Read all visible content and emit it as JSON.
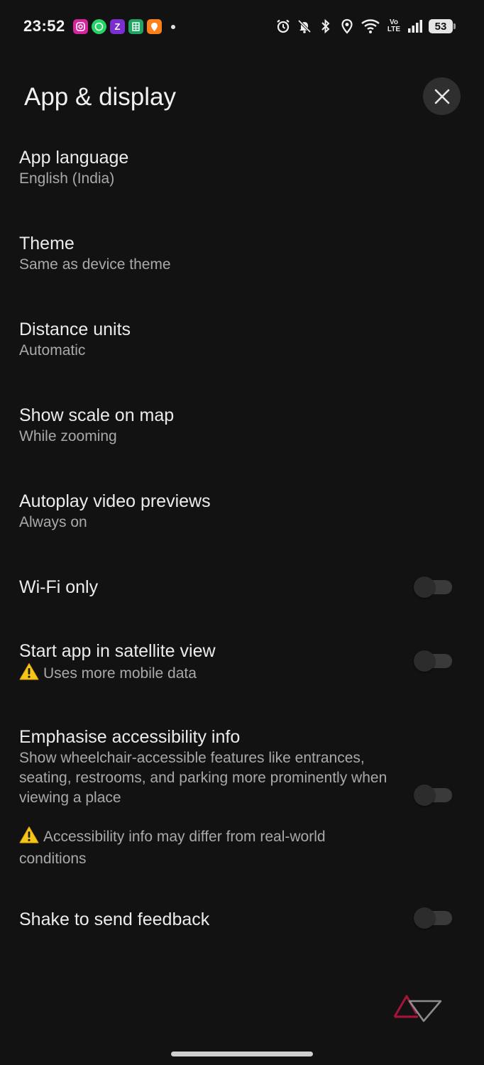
{
  "status_bar": {
    "time": "23:52",
    "battery": "53",
    "volte_top": "Vo",
    "volte_bottom": "LTE",
    "notification_icons": [
      {
        "name": "instagram-icon",
        "color": "#d6249f",
        "glyph": "◎"
      },
      {
        "name": "whatsapp-icon",
        "color": "#25d366",
        "glyph": "✆"
      },
      {
        "name": "zomato-z-icon",
        "color": "#7b2fd0",
        "glyph": "Z"
      },
      {
        "name": "sheets-icon",
        "color": "#1fa463",
        "glyph": "▦"
      },
      {
        "name": "swiggy-icon",
        "color": "#fc8019",
        "glyph": "●"
      }
    ]
  },
  "header": {
    "title": "App & display"
  },
  "settings": [
    {
      "title": "App language",
      "subtitle": "English (India)"
    },
    {
      "title": "Theme",
      "subtitle": "Same as device theme"
    },
    {
      "title": "Distance units",
      "subtitle": "Automatic"
    },
    {
      "title": "Show scale on map",
      "subtitle": "While zooming"
    },
    {
      "title": "Autoplay video previews",
      "subtitle": "Always on"
    },
    {
      "title": "Wi-Fi only",
      "toggle": false
    },
    {
      "title": "Start app in satellite view",
      "subtitle": "Uses more mobile data",
      "toggle": false
    },
    {
      "title": "Emphasise accessibility info",
      "subtitle": "Show wheelchair-accessible features like entrances, seating, restrooms, and parking more prominently when viewing a place",
      "note": "Accessibility info may differ from real-world conditions",
      "toggle": false
    },
    {
      "title": "Shake to send feedback",
      "toggle": false
    }
  ],
  "colors": {
    "background": "#121212",
    "warning": "#f5c518",
    "watermark_red": "#a3133a"
  }
}
